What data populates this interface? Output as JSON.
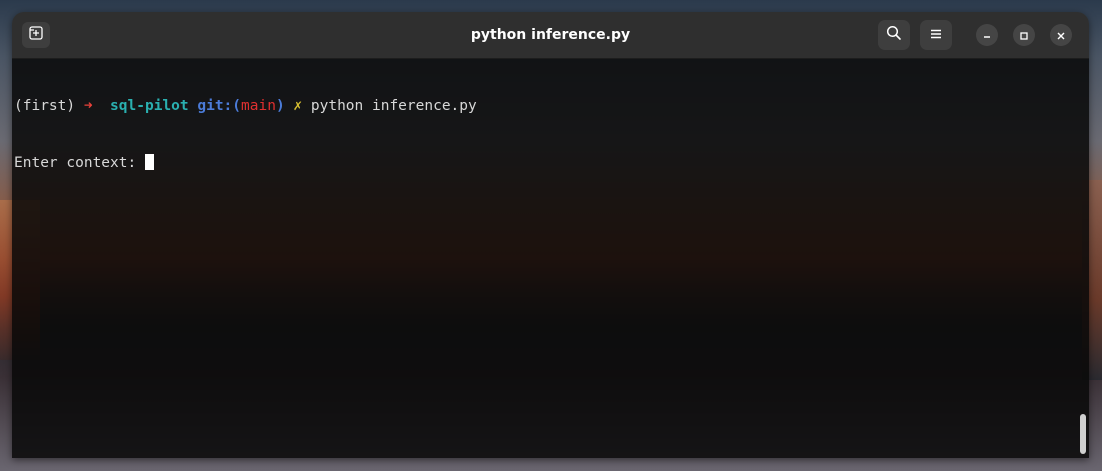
{
  "window": {
    "title": "python inference.py"
  },
  "headerbar": {
    "new_tab_icon": "new-tab-icon",
    "search_icon": "search-icon",
    "menu_icon": "hamburger-menu-icon",
    "minimize_icon": "minimize-icon",
    "maximize_icon": "maximize-icon",
    "close_icon": "close-icon"
  },
  "terminal": {
    "prompt": {
      "env": "(first)",
      "arrow": "➜",
      "repo": "sql-pilot",
      "git_label": "git:(",
      "branch": "main",
      "git_close": ")",
      "dirty_mark": "✗",
      "command": "python inference.py"
    },
    "output_line": "Enter context: "
  },
  "colors": {
    "arrow": "#e8413a",
    "repo": "#2ab0b0",
    "git": "#4b7bd8",
    "branch": "#e03030",
    "dirty_mark": "#d8c030",
    "text": "#d8d8d8",
    "headerbar": "#2f2f2f"
  }
}
